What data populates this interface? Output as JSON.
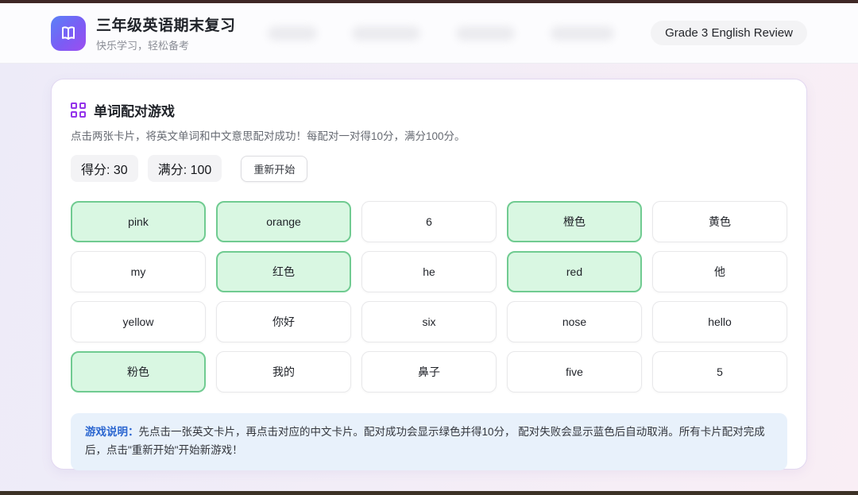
{
  "header": {
    "title": "三年级英语期末复习",
    "subtitle": "快乐学习，轻松备考",
    "badge": "Grade 3 English Review",
    "logo_icon": "open-book-icon"
  },
  "game": {
    "icon": "grid-icon",
    "title": "单词配对游戏",
    "description": "点击两张卡片，将英文单词和中文意思配对成功！每配对一对得10分，满分100分。",
    "score": {
      "label": "得分:",
      "value": "30"
    },
    "max_score": {
      "label": "满分:",
      "value": "100"
    },
    "restart_button": "重新开始",
    "cards": [
      {
        "label": "pink",
        "matched": true
      },
      {
        "label": "orange",
        "matched": true
      },
      {
        "label": "6",
        "matched": false
      },
      {
        "label": "橙色",
        "matched": true
      },
      {
        "label": "黄色",
        "matched": false
      },
      {
        "label": "my",
        "matched": false
      },
      {
        "label": "红色",
        "matched": true
      },
      {
        "label": "he",
        "matched": false
      },
      {
        "label": "red",
        "matched": true
      },
      {
        "label": "他",
        "matched": false
      },
      {
        "label": "yellow",
        "matched": false
      },
      {
        "label": "你好",
        "matched": false
      },
      {
        "label": "six",
        "matched": false
      },
      {
        "label": "nose",
        "matched": false
      },
      {
        "label": "hello",
        "matched": false
      },
      {
        "label": "粉色",
        "matched": true
      },
      {
        "label": "我的",
        "matched": false
      },
      {
        "label": "鼻子",
        "matched": false
      },
      {
        "label": "five",
        "matched": false
      },
      {
        "label": "5",
        "matched": false
      }
    ],
    "instructions": {
      "label": "游戏说明：",
      "text": "先点击一张英文卡片，再点击对应的中文卡片。配对成功会显示绿色并得10分， 配对失败会显示蓝色后自动取消。所有卡片配对完成后，点击\"重新开始\"开始新游戏！"
    }
  },
  "colors": {
    "matched_bg": "#d9f7e2",
    "matched_border": "#70cb91",
    "accent_purple": "#9333ea",
    "logo_gradient_start": "#5a82f6",
    "logo_gradient_end": "#9d4ef0",
    "info_bg": "#e8f1fb",
    "info_label_blue": "#2b66d0",
    "page_bg_left": "#edebf8",
    "page_bg_right": "#f9eef5"
  }
}
